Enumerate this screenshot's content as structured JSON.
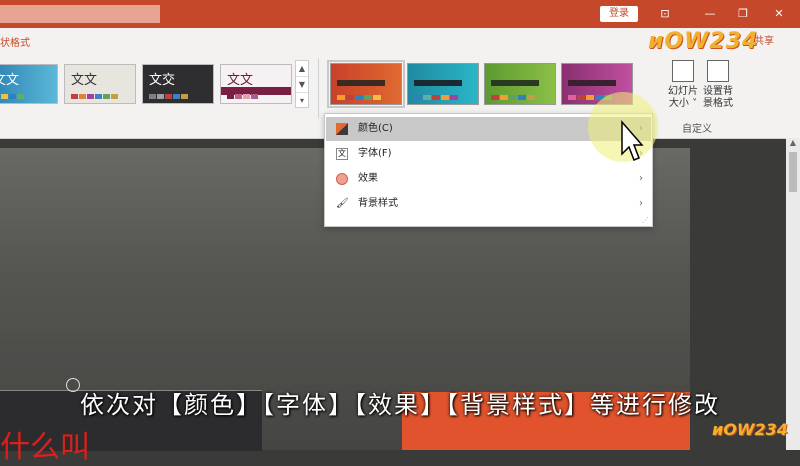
{
  "titlebar": {
    "login_label": "登录",
    "controls": [
      "⊡",
      "—",
      "❐",
      "✕"
    ]
  },
  "ribbon": {
    "tab_label": "状格式",
    "share_label": "共享",
    "theme_texts": [
      "文文",
      "文文",
      "文交",
      "文文"
    ],
    "custom_label": "自定义",
    "buttons": [
      {
        "label": "幻灯片\n大小 ˅"
      },
      {
        "label": "设置背\n景格式"
      }
    ]
  },
  "colors": {
    "accent": "#c6482a",
    "variant1": "#d9532b",
    "variant2": "#2aa8b5",
    "variant3": "#7cb342",
    "variant4": "#b3418d"
  },
  "menu": {
    "items": [
      {
        "label": "颜色(C)",
        "icon": "palette-icon",
        "has_submenu": true
      },
      {
        "label": "字体(F)",
        "icon": "font-icon",
        "has_submenu": false
      },
      {
        "label": "效果",
        "icon": "effects-icon",
        "has_submenu": true
      },
      {
        "label": "背景样式",
        "icon": "background-style-icon",
        "has_submenu": true
      }
    ]
  },
  "logo_text": "ᴎOW234",
  "caption": "依次对【颜色】【字体】【效果】【背景样式】等进行修改",
  "slide_text": "什么叫"
}
